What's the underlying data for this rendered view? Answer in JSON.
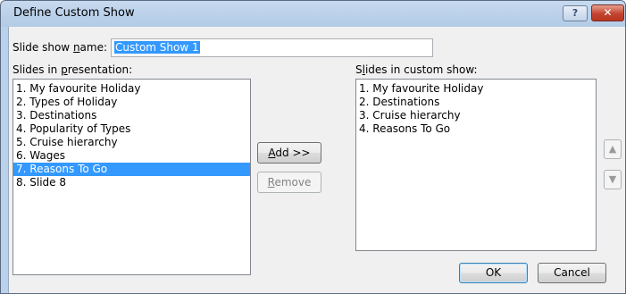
{
  "window": {
    "title": "Define Custom Show",
    "help_label": "?",
    "close_label": "✕"
  },
  "name": {
    "label_pre": "Slide show ",
    "label_ul": "n",
    "label_post": "ame:",
    "value": "Custom Show 1"
  },
  "presentation": {
    "label_pre": "Slides in ",
    "label_ul": "p",
    "label_post": "resentation:",
    "items": [
      "1. My favourite Holiday",
      "2. Types of Holiday",
      "3. Destinations",
      "4. Popularity of Types",
      "5. Cruise hierarchy",
      "6. Wages",
      "7. Reasons To Go",
      "8. Slide 8"
    ],
    "selected_index": 6
  },
  "custom": {
    "label_pre": "S",
    "label_ul": "l",
    "label_post": "ides in custom show:",
    "items": [
      "1. My favourite Holiday",
      "2. Destinations",
      "3. Cruise hierarchy",
      "4. Reasons To Go"
    ]
  },
  "buttons": {
    "add_ul": "A",
    "add_rest": "dd >>",
    "remove_ul": "R",
    "remove_rest": "emove",
    "ok": "OK",
    "cancel": "Cancel",
    "up_icon": "up-arrow-icon",
    "down_icon": "down-arrow-icon"
  },
  "colors": {
    "selection": "#3399ff",
    "titlebar": "#b9d1ea",
    "close": "#c34430"
  }
}
